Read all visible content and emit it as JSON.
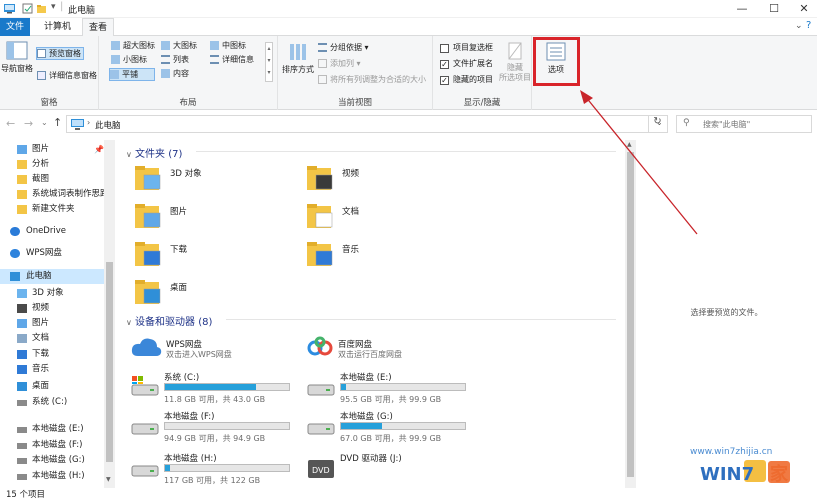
{
  "window": {
    "title": "此电脑",
    "minimize_icon": "minimize-icon",
    "maximize_icon": "maximize-icon",
    "close_icon": "close-icon"
  },
  "tabs": [
    {
      "label": "文件"
    },
    {
      "label": "计算机"
    },
    {
      "label": "查看"
    }
  ],
  "ribbon": {
    "pane": {
      "nav_pane": "导航窗格",
      "preview_pane": "预览窗格",
      "details_pane": "详细信息窗格",
      "group_label": "窗格"
    },
    "layout": {
      "options": [
        "超大图标",
        "大图标",
        "中图标",
        "小图标",
        "列表",
        "详细信息",
        "平铺",
        "内容"
      ],
      "selected": "平铺",
      "group_label": "布局"
    },
    "current_view": {
      "sort_by": "排序方式",
      "group_by": "分组依据",
      "add_column": "添加列",
      "fit_columns": "将所有列调整为合适的大小",
      "group_label": "当前视图"
    },
    "show_hide": {
      "item_checkboxes": "项目复选框",
      "file_extensions": "文件扩展名",
      "hidden_items": "隐藏的项目",
      "hide": "隐藏",
      "hide_selected": "所选项目",
      "group_label": "显示/隐藏",
      "checks": [
        false,
        true,
        true
      ]
    },
    "options_label": "选项"
  },
  "address": {
    "path": "此电脑",
    "search_placeholder": "搜索\"此电脑\""
  },
  "nav": {
    "items": [
      {
        "label": "图片",
        "icon": "pictures-icon"
      },
      {
        "label": "分析",
        "icon": "folder-icon"
      },
      {
        "label": "截图",
        "icon": "folder-icon"
      },
      {
        "label": "系统城词表制作思路",
        "icon": "folder-icon"
      },
      {
        "label": "新建文件夹",
        "icon": "folder-icon"
      },
      {
        "label": "OneDrive",
        "icon": "cloud-icon"
      },
      {
        "label": "WPS网盘",
        "icon": "wps-cloud-icon"
      },
      {
        "label": "此电脑",
        "icon": "computer-icon"
      },
      {
        "label": "3D 对象",
        "icon": "3d-objects-icon"
      },
      {
        "label": "视频",
        "icon": "video-icon"
      },
      {
        "label": "图片",
        "icon": "pictures-icon"
      },
      {
        "label": "文档",
        "icon": "documents-icon"
      },
      {
        "label": "下载",
        "icon": "download-icon"
      },
      {
        "label": "音乐",
        "icon": "music-icon"
      },
      {
        "label": "桌面",
        "icon": "desktop-icon"
      },
      {
        "label": "系统 (C:)",
        "icon": "drive-icon"
      },
      {
        "label": "本地磁盘 (E:)",
        "icon": "drive-icon"
      },
      {
        "label": "本地磁盘 (F:)",
        "icon": "drive-icon"
      },
      {
        "label": "本地磁盘 (G:)",
        "icon": "drive-icon"
      },
      {
        "label": "本地磁盘 (H:)",
        "icon": "drive-icon"
      }
    ]
  },
  "content": {
    "folders_header": "文件夹 (7)",
    "folders": [
      {
        "label": "3D 对象"
      },
      {
        "label": "视频"
      },
      {
        "label": "图片"
      },
      {
        "label": "文档"
      },
      {
        "label": "下载"
      },
      {
        "label": "音乐"
      },
      {
        "label": "桌面"
      }
    ],
    "devices_header": "设备和驱动器 (8)",
    "cloud": [
      {
        "name": "WPS网盘",
        "desc": "双击进入WPS网盘"
      },
      {
        "name": "百度网盘",
        "desc": "双击运行百度网盘"
      }
    ],
    "drives": [
      {
        "name": "系统 (C:)",
        "info": "11.8 GB 可用，共 43.0 GB",
        "used": 0.73
      },
      {
        "name": "本地磁盘 (E:)",
        "info": "95.5 GB 可用，共 99.9 GB",
        "used": 0.04
      },
      {
        "name": "本地磁盘 (F:)",
        "info": "94.9 GB 可用，共 94.9 GB",
        "used": 0.0
      },
      {
        "name": "本地磁盘 (G:)",
        "info": "67.0 GB 可用，共 99.9 GB",
        "used": 0.33
      },
      {
        "name": "本地磁盘 (H:)",
        "info": "117 GB 可用，共 122 GB",
        "used": 0.04
      },
      {
        "name": "DVD 驱动器 (J:)",
        "info": "",
        "used": null
      }
    ]
  },
  "preview": {
    "text": "选择要预览的文件。"
  },
  "status": {
    "count": "15 个项目"
  },
  "watermark": {
    "url": "www.win7zhijia.cn",
    "brand": "Win7之家"
  },
  "colors": {
    "accent": "#1979ca",
    "highlight": "#d9242a",
    "drive_bar": "#26a0da"
  }
}
